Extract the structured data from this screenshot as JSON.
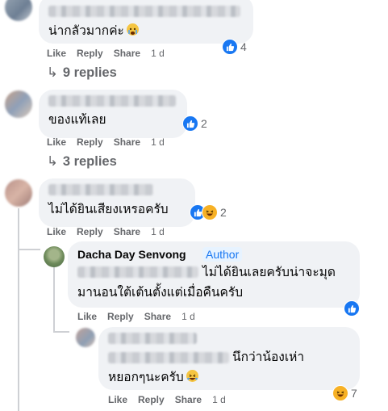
{
  "actions": {
    "like": "Like",
    "reply": "Reply",
    "share": "Share"
  },
  "comments": [
    {
      "text": "น่ากลัวมากค่ะ",
      "emoji": "crying-face-emoji",
      "time": "1 d",
      "reaction_count": "4"
    },
    {
      "text": "ของแท้เลย",
      "time": "1 d",
      "reaction_count": "2"
    },
    {
      "text": "ไม่ได้ยินเสียงเหรอครับ",
      "time": "1 d",
      "reaction_count": "2"
    }
  ],
  "reply_links": [
    "9 replies",
    "3 replies"
  ],
  "author_reply": {
    "name": "Dacha Day Senvong",
    "badge": "Author",
    "line1": "ไม่ได้ยินเลยครับน่าจะมุด",
    "line2": "มานอนใต้เต้นตั้งแต่เมื่อคืนครับ",
    "time": "1 d"
  },
  "nested_reply": {
    "line1": "นึกว่าน้องเห่า",
    "line2": "หยอกๆนะครับ",
    "emoji": "rofl-emoji",
    "time": "1 d",
    "reaction_count": "7"
  },
  "colors": {
    "like_blue": "#1877f2",
    "haha_yellow": "#f7b125",
    "bubble_gray": "#f0f2f5",
    "meta_gray": "#65676b"
  }
}
